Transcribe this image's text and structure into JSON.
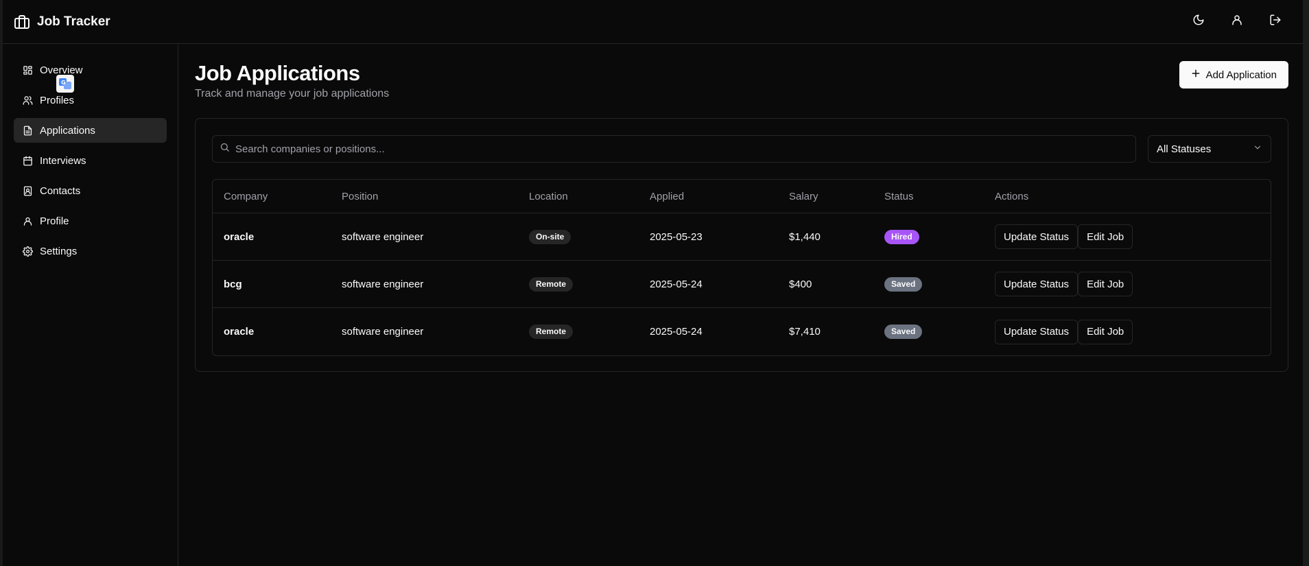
{
  "header": {
    "title": "Job Tracker",
    "icons": [
      "briefcase-icon",
      "moon-icon",
      "user-icon",
      "logout-icon"
    ]
  },
  "sidebar": {
    "items": [
      {
        "label": "Overview",
        "icon": "grid-icon",
        "active": false
      },
      {
        "label": "Profiles",
        "icon": "users-icon",
        "active": false
      },
      {
        "label": "Applications",
        "icon": "file-text-icon",
        "active": true
      },
      {
        "label": "Interviews",
        "icon": "calendar-icon",
        "active": false
      },
      {
        "label": "Contacts",
        "icon": "contact-book-icon",
        "active": false
      },
      {
        "label": "Profile",
        "icon": "user-icon",
        "active": false
      },
      {
        "label": "Settings",
        "icon": "gear-icon",
        "active": false
      }
    ]
  },
  "main": {
    "title": "Job Applications",
    "subtitle": "Track and manage your job applications",
    "add_button": "Add Application",
    "search": {
      "placeholder": "Search companies or positions...",
      "value": ""
    },
    "status_filter": {
      "selected": "All Statuses"
    },
    "table": {
      "columns": [
        "Company",
        "Position",
        "Location",
        "Applied",
        "Salary",
        "Status",
        "Actions"
      ],
      "rows": [
        {
          "company": "oracle",
          "position": "software engineer",
          "location": "On-site",
          "applied": "2025-05-23",
          "salary": "$1,440",
          "status": "Hired"
        },
        {
          "company": "bcg",
          "position": "software engineer",
          "location": "Remote",
          "applied": "2025-05-24",
          "salary": "$400",
          "status": "Saved"
        },
        {
          "company": "oracle",
          "position": "software engineer",
          "location": "Remote",
          "applied": "2025-05-24",
          "salary": "$7,410",
          "status": "Saved"
        }
      ],
      "actions": {
        "update": "Update Status",
        "edit": "Edit Job"
      }
    }
  },
  "colors": {
    "background": "#0a0a0a",
    "border": "#262626",
    "hired": "#a855f7",
    "saved": "#6b7280",
    "muted_text": "#a1a1aa"
  }
}
